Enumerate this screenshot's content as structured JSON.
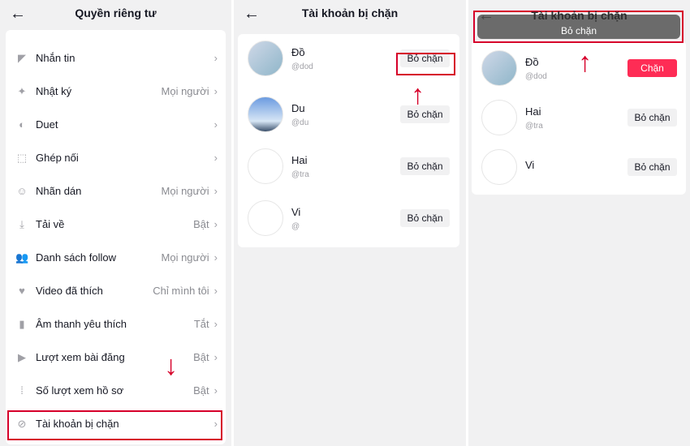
{
  "privacy": {
    "title": "Quyền riêng tư",
    "items": [
      {
        "icon": "send-icon",
        "label": "Nhắn tin",
        "value": ""
      },
      {
        "icon": "sparkle-icon",
        "label": "Nhật ký",
        "value": "Mọi người"
      },
      {
        "icon": "duet-icon",
        "label": "Duet",
        "value": ""
      },
      {
        "icon": "stitch-icon",
        "label": "Ghép nối",
        "value": ""
      },
      {
        "icon": "sticker-icon",
        "label": "Nhãn dán",
        "value": "Mọi người"
      },
      {
        "icon": "download-icon",
        "label": "Tải về",
        "value": "Bật"
      },
      {
        "icon": "people-icon",
        "label": "Danh sách follow",
        "value": "Mọi người"
      },
      {
        "icon": "heart-icon",
        "label": "Video đã thích",
        "value": "Chỉ mình tôi"
      },
      {
        "icon": "bookmark-icon",
        "label": "Âm thanh yêu thích",
        "value": "Tắt"
      },
      {
        "icon": "play-icon",
        "label": "Lượt xem bài đăng",
        "value": "Bật"
      },
      {
        "icon": "footprint-icon",
        "label": "Số lượt xem hồ sơ",
        "value": "Bật"
      },
      {
        "icon": "block-icon",
        "label": "Tài khoản bị chặn",
        "value": ""
      }
    ]
  },
  "blocked": {
    "title": "Tài khoản bị chặn",
    "unblock_label": "Bỏ chặn",
    "users": [
      {
        "name": "Đồ",
        "handle": "@dod"
      },
      {
        "name": "Du",
        "handle": "@du"
      },
      {
        "name": "Hai",
        "handle": "@tra"
      },
      {
        "name": "Vi",
        "handle": "@"
      }
    ]
  },
  "after": {
    "title": "Tài khoản bị chặn",
    "toast": "Bỏ chặn",
    "block_label": "Chặn",
    "unblock_label": "Bỏ chặn",
    "users": [
      {
        "name": "Đồ",
        "handle": "@dod"
      },
      {
        "name": "Hai",
        "handle": "@tra"
      },
      {
        "name": "Vi",
        "handle": ""
      }
    ]
  },
  "colors": {
    "accent": "#fe2c55",
    "highlight": "#d6002a"
  }
}
